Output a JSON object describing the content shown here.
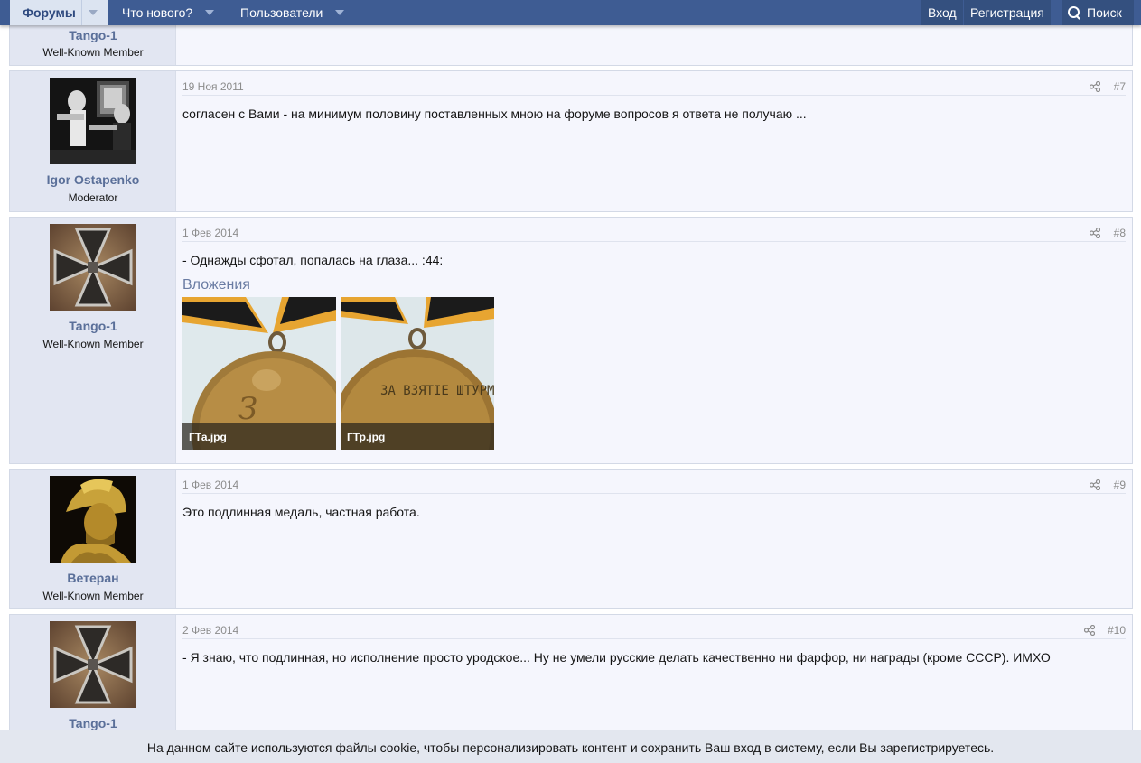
{
  "nav": {
    "tabs": [
      {
        "label": "Форумы",
        "active": true
      },
      {
        "label": "Что нового?"
      },
      {
        "label": "Пользователи"
      }
    ],
    "login": "Вход",
    "register": "Регистрация",
    "search": "Поиск"
  },
  "posts": [
    {
      "username": "Tango-1",
      "user_title": "Well-Known Member"
    },
    {
      "username": "Igor Ostapenko",
      "user_title": "Moderator",
      "date": "19 Ноя 2011",
      "number": "#7",
      "text": "согласен с Вами - на минимум половину поставленных мною на форуме вопросов я ответа не получаю ..."
    },
    {
      "username": "Tango-1",
      "user_title": "Well-Known Member",
      "date": "1 Фев 2014",
      "number": "#8",
      "text": "- Однажды сфотал, попалась на глаза... :44:",
      "attachments_header": "Вложения",
      "attachments": [
        {
          "name": "ГТа.jpg",
          "text": "З"
        },
        {
          "name": "ГТр.jpg",
          "text": "ЗА ВЗЯТIЕ ШТУРМОМЪ"
        }
      ]
    },
    {
      "username": "Ветеран",
      "user_title": "Well-Known Member",
      "date": "1 Фев 2014",
      "number": "#9",
      "text": "Это подлинная медаль, частная работа."
    },
    {
      "username": "Tango-1",
      "date": "2 Фев 2014",
      "number": "#10",
      "text": "- Я знаю, что подлинная, но исполнение просто уродское... Ну не умели русские делать качественно ни фарфор, ни награды (кроме СССР). ИМХО"
    }
  ],
  "cookie_notice": {
    "line1": "На данном сайте используются файлы cookie, чтобы персонализировать контент и сохранить Ваш вход в систему, если Вы зарегистрируетесь."
  },
  "colors": {
    "nav_bg": "#3e5c93",
    "username": "#5a6f99",
    "post_bg": "#f5f6fd",
    "user_col_bg": "#e2e6f2"
  }
}
